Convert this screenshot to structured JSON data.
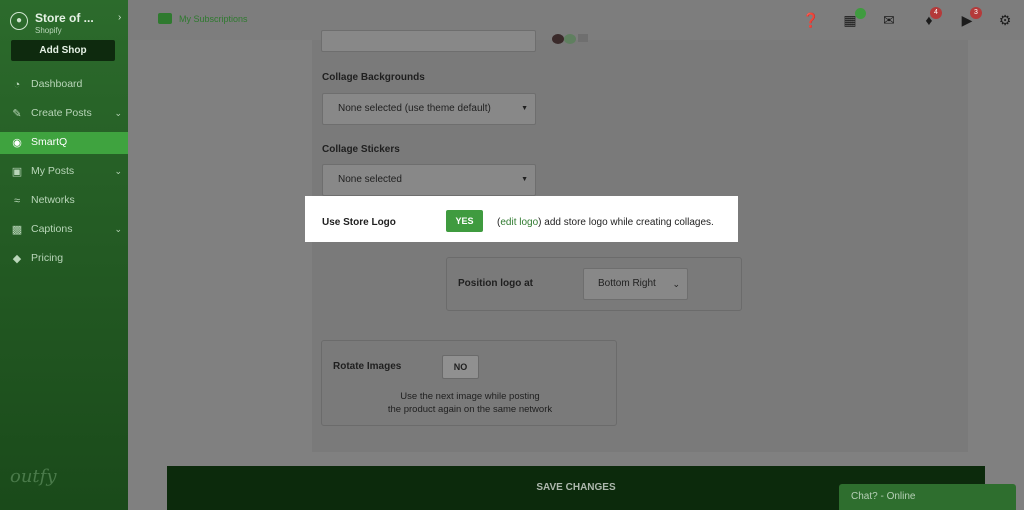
{
  "sidebar": {
    "store_name": "Store of ...",
    "store_sub": "Shopify",
    "add_shop": "Add Shop",
    "items": [
      {
        "label": "Dashboard",
        "icon": "gauge-icon"
      },
      {
        "label": "Create Posts",
        "icon": "pencil-icon"
      },
      {
        "label": "SmartQ",
        "icon": "eye-icon"
      },
      {
        "label": "My Posts",
        "icon": "inbox-icon"
      },
      {
        "label": "Networks",
        "icon": "wifi-icon"
      },
      {
        "label": "Captions",
        "icon": "comment-icon"
      },
      {
        "label": "Pricing",
        "icon": "tag-icon"
      }
    ],
    "brand": "outfy"
  },
  "topbar": {
    "subscriptions_label": "My Subscriptions",
    "notification_badge": "4",
    "announce_badge": "3"
  },
  "form": {
    "collage_backgrounds_label": "Collage Backgrounds",
    "collage_backgrounds_value": "None selected (use theme default)",
    "collage_stickers_label": "Collage Stickers",
    "collage_stickers_value": "None selected",
    "use_store_logo_label": "Use Store Logo",
    "use_store_logo_toggle": "YES",
    "edit_logo_link": "edit logo",
    "edit_logo_open": "(",
    "edit_logo_rest": ") add store logo while creating collages.",
    "position_logo_label": "Position logo at",
    "position_logo_value": "Bottom Right",
    "rotate_images_label": "Rotate Images",
    "rotate_images_toggle": "NO",
    "rotate_hint_1": "Use the next image while posting",
    "rotate_hint_2": "the product again on the same network"
  },
  "footer": {
    "save_label": "SAVE CHANGES",
    "chat_label": "Chat? - Online"
  },
  "colors": {
    "brand_green": "#3fa33f",
    "save_bar": "#0c2a0c"
  }
}
